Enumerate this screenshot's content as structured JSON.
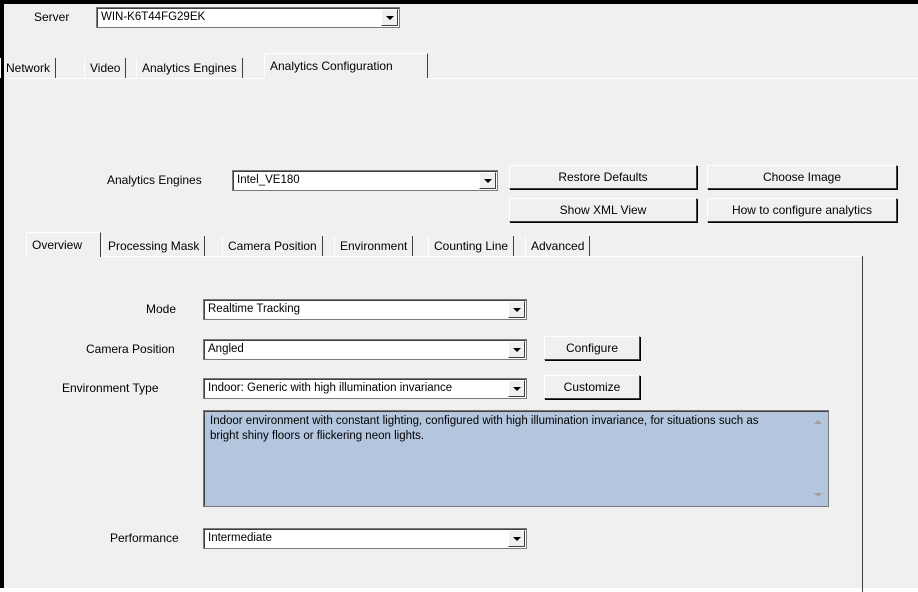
{
  "server": {
    "label": "Server",
    "value": "WIN-K6T44FG29EK"
  },
  "top_tabs": [
    "Network",
    "Video",
    "Analytics Engines",
    "Analytics Configuration"
  ],
  "engines": {
    "label": "Analytics Engines",
    "value": "Intel_VE180"
  },
  "buttons": {
    "restore_defaults": "Restore Defaults",
    "choose_image": "Choose Image",
    "show_xml": "Show XML View",
    "how_to": "How to configure analytics",
    "configure": "Configure",
    "customize": "Customize"
  },
  "sub_tabs": [
    "Overview",
    "Processing Mask",
    "Camera Position",
    "Environment",
    "Counting Line",
    "Advanced"
  ],
  "form": {
    "mode": {
      "label": "Mode",
      "value": "Realtime Tracking"
    },
    "camera_position": {
      "label": "Camera Position",
      "value": "Angled"
    },
    "environment_type": {
      "label": "Environment Type",
      "value": "Indoor: Generic with high illumination invariance"
    },
    "description": "Indoor environment with constant lighting, configured with high illumination invariance, for situations such as bright shiny floors or flickering neon lights.",
    "performance": {
      "label": "Performance",
      "value": "Intermediate"
    }
  }
}
